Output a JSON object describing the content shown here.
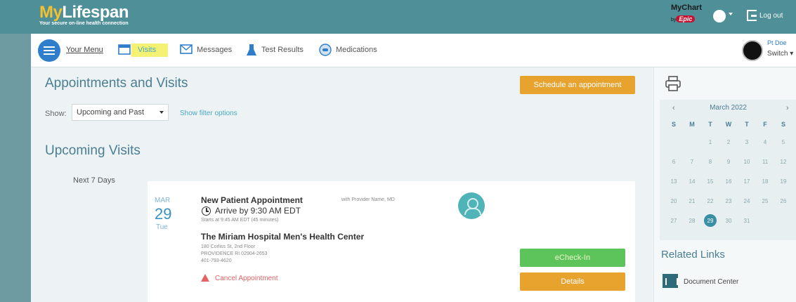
{
  "brand": {
    "logo_prefix": "My",
    "logo_name": "Lifespan",
    "tagline": "Your secure on-line health connection",
    "mychart": "MyChart",
    "by": "by",
    "epic": "Epic",
    "logout": "Log out"
  },
  "nav": {
    "menu_label": "Your Menu",
    "items": [
      {
        "label": "Visits",
        "icon": "calendar-icon"
      },
      {
        "label": "Messages",
        "icon": "envelope-icon"
      },
      {
        "label": "Test Results",
        "icon": "flask-icon"
      },
      {
        "label": "Medications",
        "icon": "pill-icon"
      }
    ],
    "user_name": "Pt Doe",
    "switch_label": "Switch ▾"
  },
  "main": {
    "title": "Appointments and Visits",
    "schedule_label": "Schedule an appointment",
    "show_label": "Show:",
    "show_value": "Upcoming and Past",
    "filter_link": "Show filter options",
    "upcoming_title": "Upcoming Visits",
    "next_days": "Next 7 Days"
  },
  "visit": {
    "month": "MAR",
    "day": "29",
    "weekday": "Tue",
    "title": "New Patient Appointment",
    "with": "with Provider Name, MD",
    "arrive": "Arrive by 9:30 AM EDT",
    "starts": "Starts at 9:45 AM EDT (45 minutes)",
    "location": "The Miriam Hospital Men's Health Center",
    "address": [
      "180 Corliss St, 2nd Floor",
      "PROVIDENCE RI 02904-2653",
      "401-793-4620"
    ],
    "echeckin_label": "eCheck-In",
    "details_label": "Details",
    "cancel_label": "Cancel Appointment"
  },
  "sidebar": {
    "calendar_month": "March 2022",
    "weekdays": [
      "S",
      "M",
      "T",
      "W",
      "T",
      "F",
      "S"
    ],
    "weeks": [
      [
        "",
        "",
        "1",
        "2",
        "3",
        "4",
        "5"
      ],
      [
        "6",
        "7",
        "8",
        "9",
        "10",
        "11",
        "12"
      ],
      [
        "13",
        "14",
        "15",
        "16",
        "17",
        "18",
        "19"
      ],
      [
        "20",
        "21",
        "22",
        "23",
        "24",
        "25",
        "26"
      ],
      [
        "27",
        "28",
        "29",
        "30",
        "31",
        "",
        ""
      ]
    ],
    "selected_day": "29",
    "related_title": "Related Links",
    "document_center": "Document Center"
  },
  "colors": {
    "banner": "#4e8f98",
    "accent_blue": "#2e7ecb",
    "orange": "#e8a22e",
    "green": "#5cc45a",
    "title_teal": "#4a7e93"
  }
}
